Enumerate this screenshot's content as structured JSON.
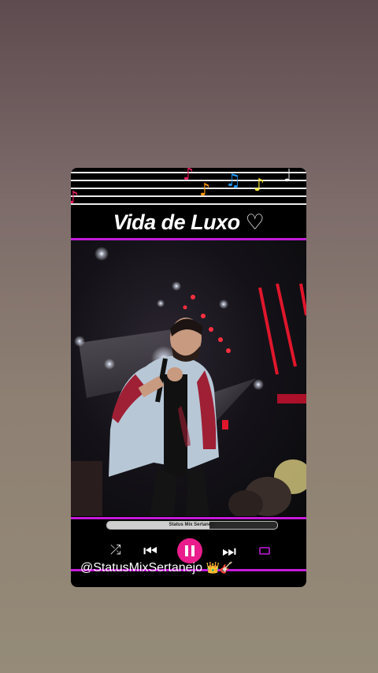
{
  "title": "Vida de Luxo",
  "title_heart": "♡",
  "progress": {
    "label": "Status Mix Sertanejo",
    "fraction": 0.6
  },
  "controls": {
    "shuffle_icon": "shuffle-icon",
    "previous_icon": "previous-icon",
    "pause_icon": "pause-icon",
    "next_icon": "next-icon",
    "repeat_icon": "repeat-icon"
  },
  "handle": "@StatusMixSertanejo",
  "handle_emoji": "👑🎸",
  "colors": {
    "accent_magenta": "#c31bd9",
    "play_pink": "#e91e8c"
  }
}
